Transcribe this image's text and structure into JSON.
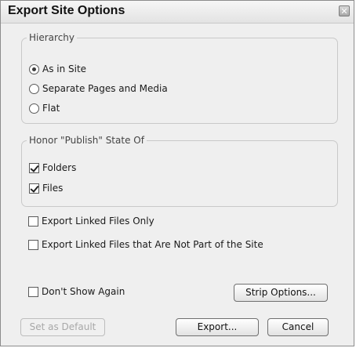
{
  "window": {
    "title": "Export Site Options",
    "close_glyph": "✕"
  },
  "hierarchy": {
    "label": "Hierarchy",
    "options": [
      {
        "label": "As in Site",
        "selected": true
      },
      {
        "label": "Separate Pages and Media",
        "selected": false
      },
      {
        "label": "Flat",
        "selected": false
      }
    ]
  },
  "publish_state": {
    "label": "Honor \"Publish\" State Of",
    "options": [
      {
        "label": "Folders",
        "checked": true
      },
      {
        "label": "Files",
        "checked": true
      }
    ]
  },
  "export_options": [
    {
      "label": "Export Linked Files Only",
      "checked": false
    },
    {
      "label": "Export Linked Files that Are Not Part of the Site",
      "checked": false
    }
  ],
  "dont_show_again": {
    "label": "Don't Show Again",
    "checked": false
  },
  "buttons": {
    "strip_options": "Strip Options...",
    "set_as_default": "Set as Default",
    "export": "Export...",
    "cancel": "Cancel"
  }
}
